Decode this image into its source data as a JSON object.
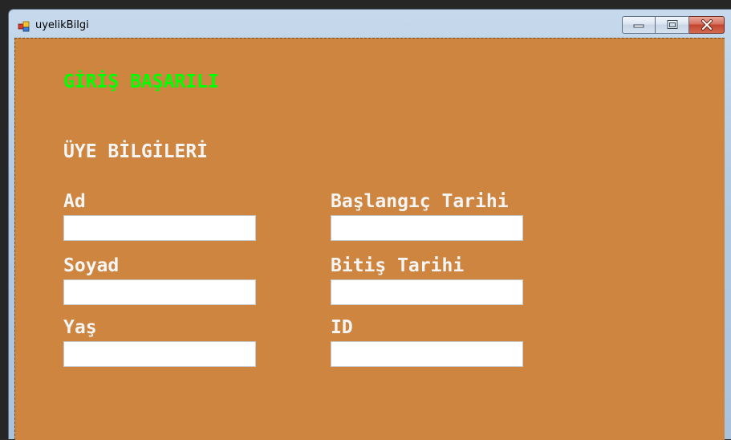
{
  "window": {
    "title": "uyelikBilgi",
    "icon": "windows-form-icon"
  },
  "caption_buttons": {
    "minimize_icon": "minimize-icon",
    "maximize_icon": "maximize-icon",
    "close_icon": "close-icon"
  },
  "colors": {
    "form_background": "#cd853f",
    "success_text": "#00ff00",
    "label_text": "#f5f5f5"
  },
  "form": {
    "status_message": "GİRİŞ BAŞARILI",
    "section_title": "ÜYE BİLGİLERİ",
    "fields": {
      "ad": {
        "label": "Ad",
        "value": ""
      },
      "soyad": {
        "label": "Soyad",
        "value": ""
      },
      "yas": {
        "label": "Yaş",
        "value": ""
      },
      "baslangic_tarihi": {
        "label": "Başlangıç Tarihi",
        "value": ""
      },
      "bitis_tarihi": {
        "label": "Bitiş Tarihi",
        "value": ""
      },
      "id": {
        "label": "ID",
        "value": ""
      }
    }
  }
}
